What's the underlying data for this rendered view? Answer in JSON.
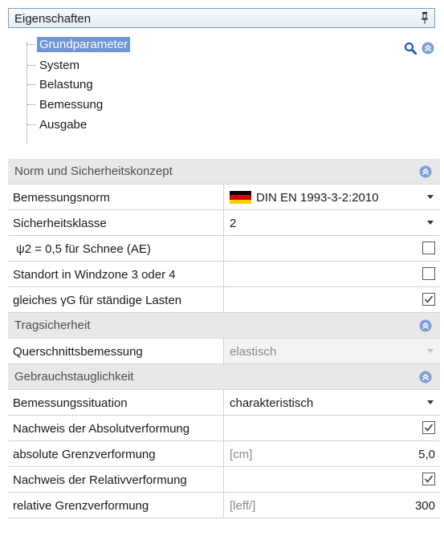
{
  "panel": {
    "title": "Eigenschaften"
  },
  "tree": {
    "items": [
      "Grundparameter",
      "System",
      "Belastung",
      "Bemessung",
      "Ausgabe"
    ]
  },
  "sections": {
    "norm": {
      "title": "Norm und Sicherheitskonzept",
      "bemessungsnorm": {
        "label": "Bemessungsnorm",
        "value": "DIN EN 1993-3-2:2010"
      },
      "sicherheitsklasse": {
        "label": "Sicherheitsklasse",
        "value": "2"
      },
      "psi2": {
        "label": "ψ2 = 0,5 für Schnee (AE)",
        "checked": false
      },
      "windzone": {
        "label": "Standort in Windzone 3 oder 4",
        "checked": false
      },
      "gleiches_gamma": {
        "label": "gleiches γG für ständige Lasten",
        "checked": true
      }
    },
    "trag": {
      "title": "Tragsicherheit",
      "querschnitt": {
        "label": "Querschnittsbemessung",
        "value": "elastisch"
      }
    },
    "gebrauch": {
      "title": "Gebrauchstauglichkeit",
      "situation": {
        "label": "Bemessungssituation",
        "value": "charakteristisch"
      },
      "absolut_nachweis": {
        "label": "Nachweis der Absolutverformung",
        "checked": true
      },
      "absolut_grenz": {
        "label": "absolute Grenzverformung",
        "unit": "[cm]",
        "value": "5,0"
      },
      "relativ_nachweis": {
        "label": "Nachweis der Relativverformung",
        "checked": true
      },
      "relativ_grenz": {
        "label": "relative Grenzverformung",
        "unit": "[leff/]",
        "value": "300"
      }
    }
  },
  "colors": {
    "selection": "#6f96d6",
    "section_bg": "#e8e8e8",
    "collapse_icon": "#7ba0d6"
  }
}
